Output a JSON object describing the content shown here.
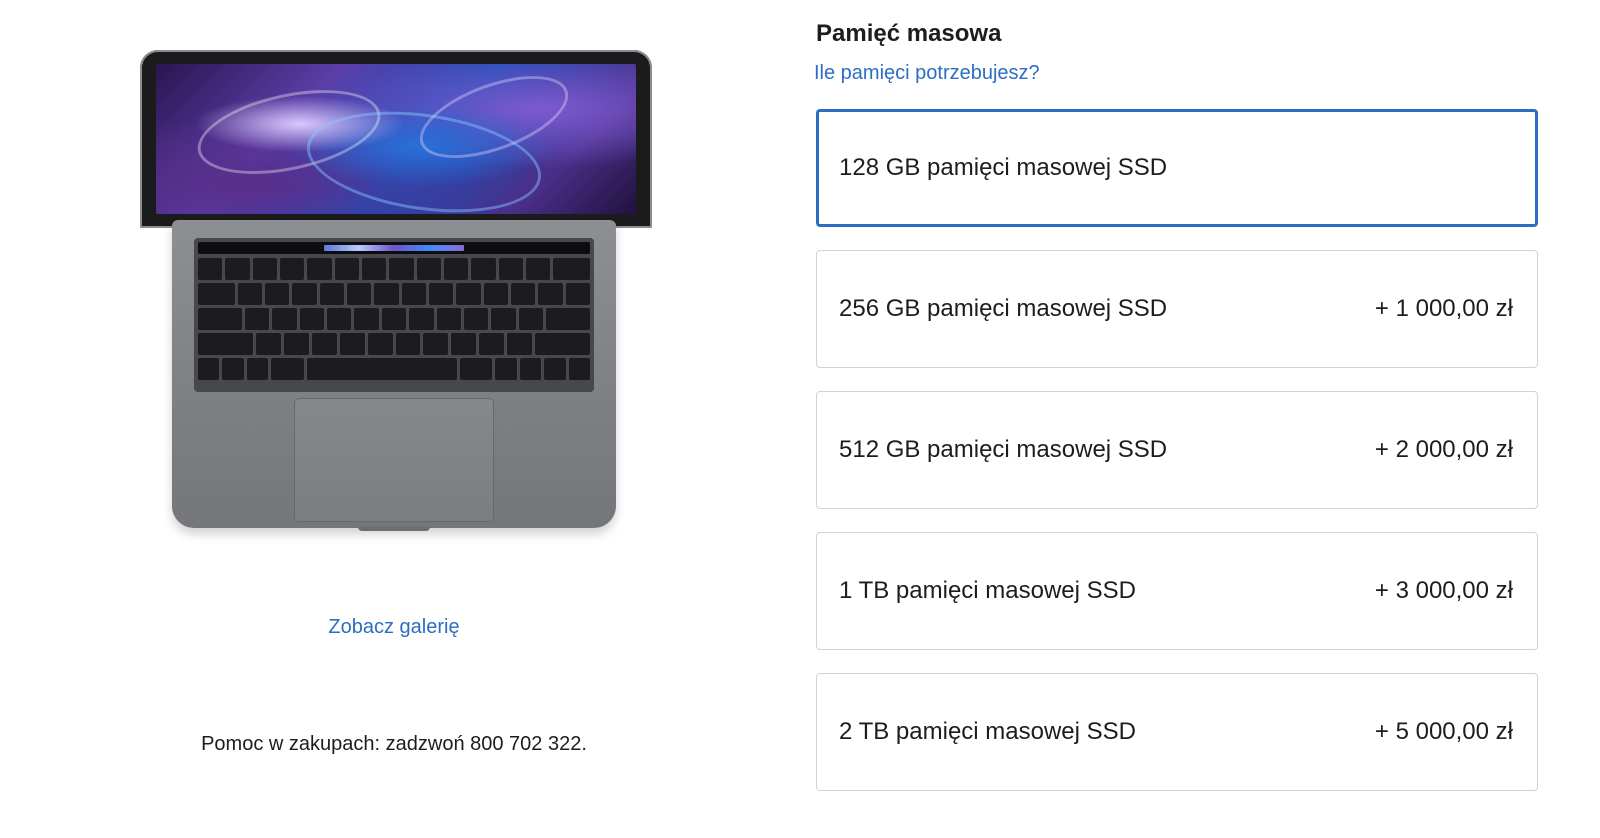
{
  "left": {
    "product_image_alt": "MacBook Pro",
    "gallery_link": "Zobacz galerię",
    "help_text": "Pomoc w zakupach: zadzwoń 800 702 322."
  },
  "storage": {
    "title": "Pamięć masowa",
    "help_link": "Ile pamięci potrzebujesz?",
    "selected_index": 0,
    "accent_color": "#2d6dc4",
    "options": [
      {
        "label": "128 GB pamięci masowej SSD",
        "price": ""
      },
      {
        "label": "256 GB pamięci masowej SSD",
        "price": "+ 1 000,00 zł"
      },
      {
        "label": "512 GB pamięci masowej SSD",
        "price": "+ 2 000,00 zł"
      },
      {
        "label": "1 TB pamięci masowej SSD",
        "price": "+ 3 000,00 zł"
      },
      {
        "label": "2 TB pamięci masowej SSD",
        "price": "+ 5 000,00 zł"
      }
    ]
  }
}
